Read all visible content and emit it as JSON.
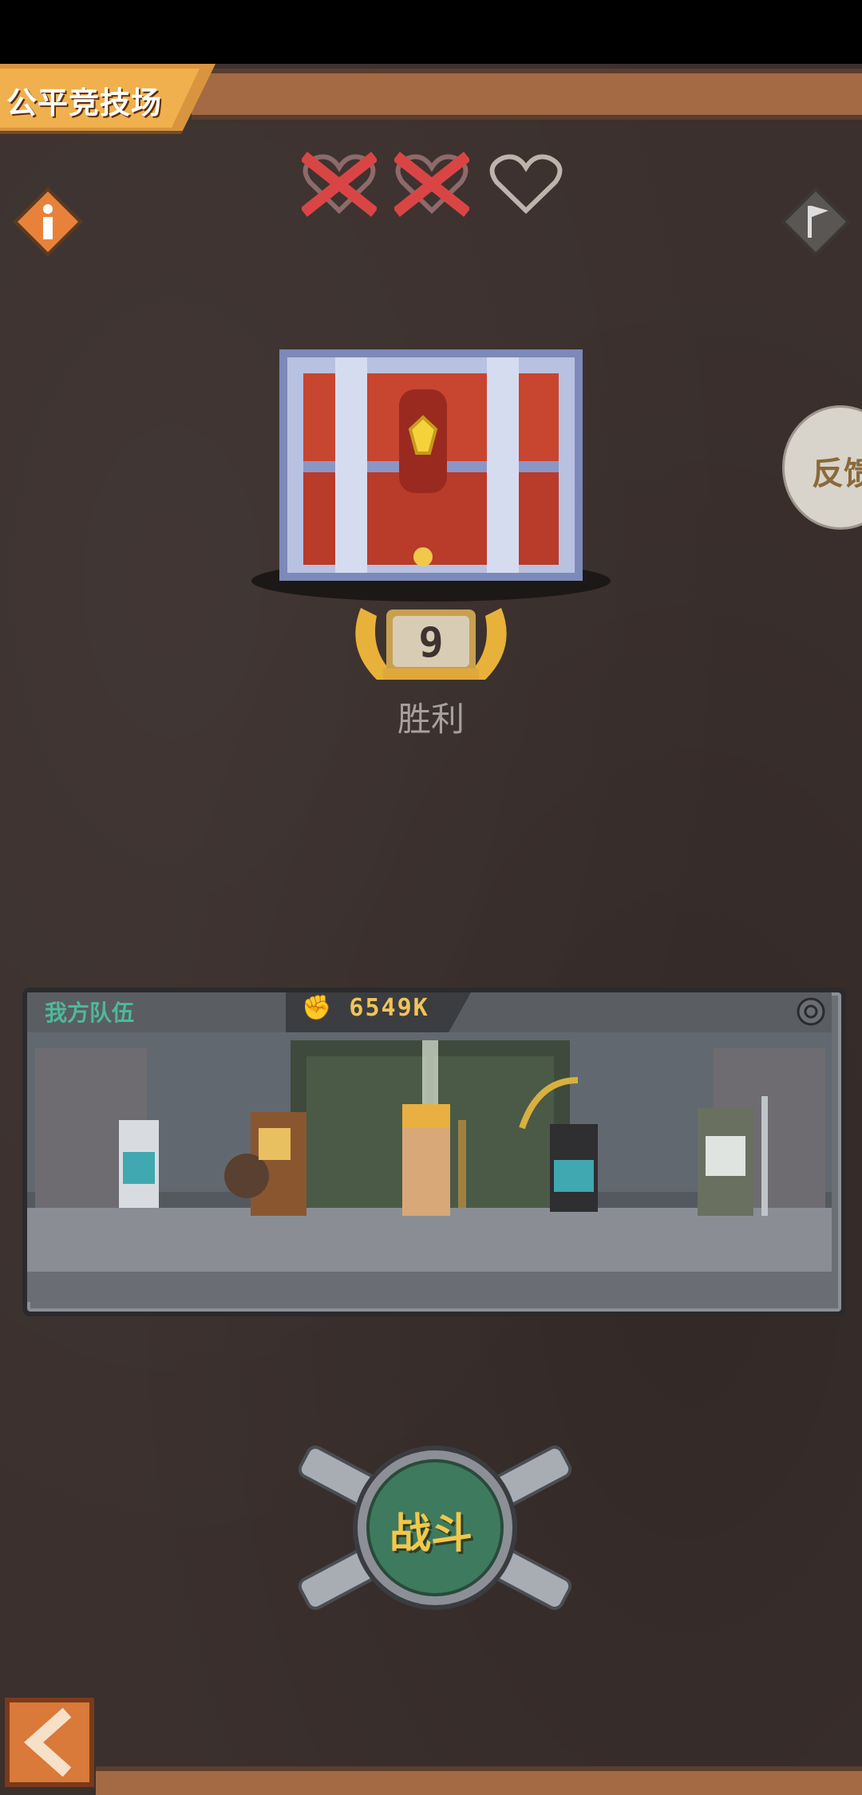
{
  "header": {
    "title": "公平竞技场"
  },
  "lives": [
    {
      "state": "lost",
      "icon": "heart-crossed-icon"
    },
    {
      "state": "lost",
      "icon": "heart-crossed-icon"
    },
    {
      "state": "remaining",
      "icon": "heart-outline-icon"
    }
  ],
  "side_buttons": {
    "info_icon": "info-icon",
    "flag_icon": "flag-icon",
    "feedback_label": "反馈"
  },
  "reward": {
    "chest_icon": "treasure-chest-icon",
    "wins": "9",
    "wins_label": "胜利"
  },
  "team": {
    "label": "我方队伍",
    "power": "6549K",
    "power_icon": "fist-icon",
    "settings_icon": "settings-icon"
  },
  "fight": {
    "label": "战斗"
  },
  "navigation": {
    "back_icon": "chevron-left-icon"
  },
  "colors": {
    "background": "#3b302d",
    "accent_orange": "#f0b04d",
    "fight_green": "#3e7a5e",
    "lost_red": "#d94545",
    "team_label": "#4fb89a",
    "power_gold": "#f0c45a"
  }
}
